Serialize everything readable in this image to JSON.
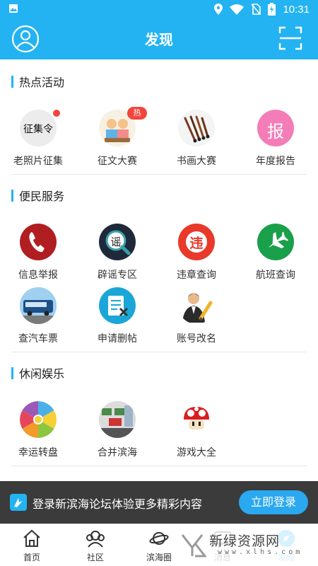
{
  "status_bar": {
    "time": "10:31"
  },
  "header": {
    "title": "发现"
  },
  "sections": [
    {
      "title": "热点活动",
      "items": [
        {
          "label": "老照片征集",
          "icon": "old-photo-calligraphy-icon",
          "badge": "dot"
        },
        {
          "label": "征文大赛",
          "icon": "essay-kids-icon",
          "badge": "热"
        },
        {
          "label": "书画大赛",
          "icon": "brushes-icon"
        },
        {
          "label": "年度报告",
          "icon": "report-icon",
          "glyph": "报"
        }
      ]
    },
    {
      "title": "便民服务",
      "items": [
        {
          "label": "信息举报",
          "icon": "phone-report-icon"
        },
        {
          "label": "辟谣专区",
          "icon": "rumor-magnifier-icon",
          "glyph": "谣"
        },
        {
          "label": "违章查询",
          "icon": "violation-icon",
          "glyph": "违"
        },
        {
          "label": "航班查询",
          "icon": "airplane-icon"
        },
        {
          "label": "查汽车票",
          "icon": "bus-icon"
        },
        {
          "label": "申请删帖",
          "icon": "delete-post-icon"
        },
        {
          "label": "账号改名",
          "icon": "rename-account-icon"
        }
      ]
    },
    {
      "title": "休闲娱乐",
      "items": [
        {
          "label": "幸运转盘",
          "icon": "lucky-wheel-icon"
        },
        {
          "label": "合并滨海",
          "icon": "merge-binhai-icon"
        },
        {
          "label": "游戏大全",
          "icon": "mushroom-game-icon"
        }
      ]
    }
  ],
  "login_banner": {
    "text": "登录新滨海论坛体验更多精彩内容",
    "button": "立即登录"
  },
  "tabs": [
    {
      "label": "首页",
      "icon": "home-icon"
    },
    {
      "label": "社区",
      "icon": "community-icon"
    },
    {
      "label": "滨海圈",
      "icon": "planet-icon"
    },
    {
      "label": "消息",
      "icon": "message-icon"
    },
    {
      "label": "发现",
      "icon": "discover-icon",
      "active": true
    }
  ],
  "watermark": {
    "main": "新绿资源网",
    "sub": "www.xlhs.com"
  },
  "colors": {
    "primary": "#23b3f2",
    "badge": "#f2453d",
    "banner_bg": "#3b3b3b"
  }
}
